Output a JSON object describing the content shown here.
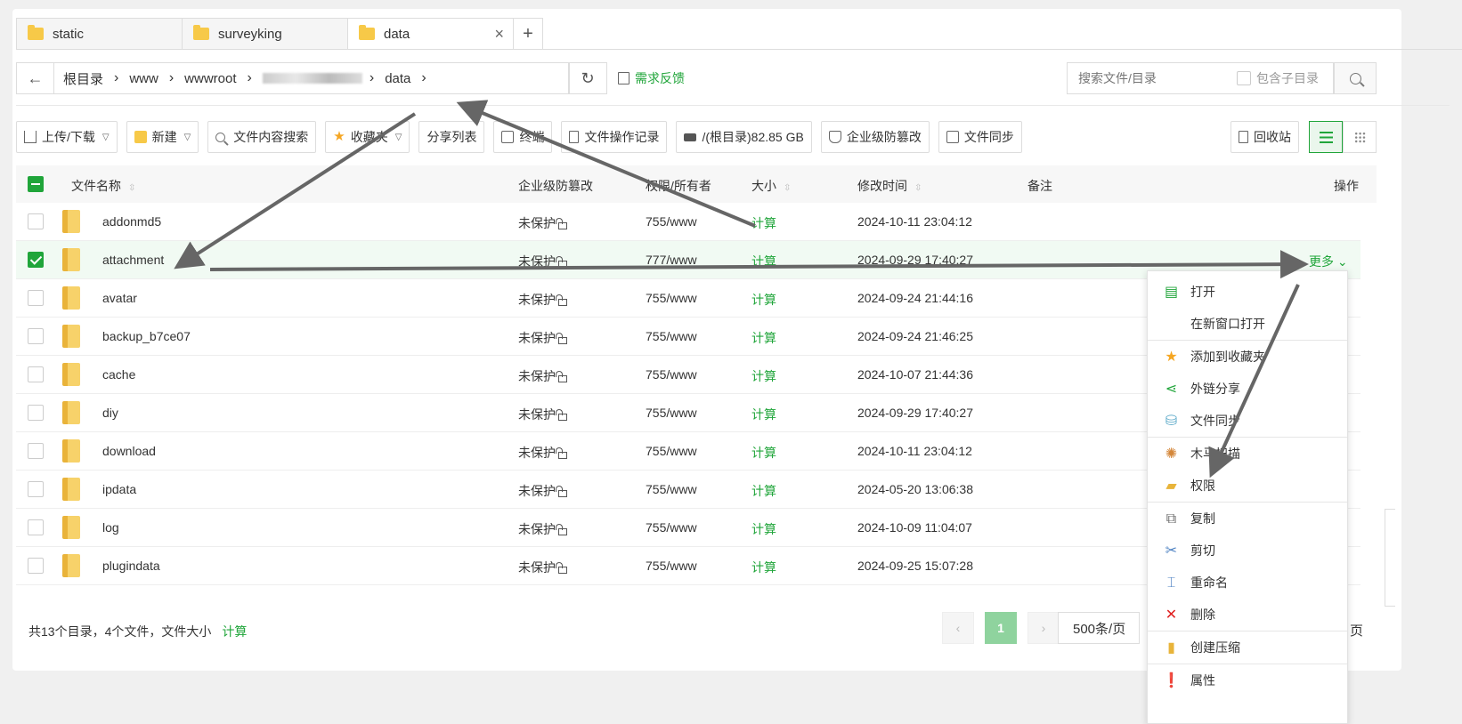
{
  "tabs": [
    {
      "label": "static"
    },
    {
      "label": "surveyking"
    },
    {
      "label": "data"
    }
  ],
  "tab_add": "+",
  "tab_close": "×",
  "breadcrumbs": [
    "根目录",
    "www",
    "wwwroot",
    "data"
  ],
  "feedback": "需求反馈",
  "search": {
    "placeholder": "搜索文件/目录",
    "include_sub": "包含子目录"
  },
  "toolbar": {
    "upload": "上传/下载",
    "new": "新建",
    "content_search": "文件内容搜索",
    "favorites": "收藏夹",
    "share_list": "分享列表",
    "terminal": "终端",
    "op_log": "文件操作记录",
    "disk": "/(根目录)82.85 GB",
    "tamper": "企业级防篡改",
    "sync": "文件同步",
    "recycle": "回收站"
  },
  "table": {
    "headers": {
      "name": "文件名称",
      "tamper": "企业级防篡改",
      "perm": "权限/所有者",
      "size": "大小",
      "mtime": "修改时间",
      "remark": "备注",
      "ops": "操作"
    },
    "rows": [
      {
        "name": "addonmd5",
        "tamper": "未保护",
        "perm": "755/www",
        "size": "计算",
        "mtime": "2024-10-11 23:04:12"
      },
      {
        "name": "attachment",
        "tamper": "未保护",
        "perm": "777/www",
        "size": "计算",
        "mtime": "2024-09-29 17:40:27",
        "ops": "更多"
      },
      {
        "name": "avatar",
        "tamper": "未保护",
        "perm": "755/www",
        "size": "计算",
        "mtime": "2024-09-24 21:44:16"
      },
      {
        "name": "backup_b7ce07",
        "tamper": "未保护",
        "perm": "755/www",
        "size": "计算",
        "mtime": "2024-09-24 21:46:25"
      },
      {
        "name": "cache",
        "tamper": "未保护",
        "perm": "755/www",
        "size": "计算",
        "mtime": "2024-10-07 21:44:36"
      },
      {
        "name": "diy",
        "tamper": "未保护",
        "perm": "755/www",
        "size": "计算",
        "mtime": "2024-09-29 17:40:27"
      },
      {
        "name": "download",
        "tamper": "未保护",
        "perm": "755/www",
        "size": "计算",
        "mtime": "2024-10-11 23:04:12"
      },
      {
        "name": "ipdata",
        "tamper": "未保护",
        "perm": "755/www",
        "size": "计算",
        "mtime": "2024-05-20 13:06:38"
      },
      {
        "name": "log",
        "tamper": "未保护",
        "perm": "755/www",
        "size": "计算",
        "mtime": "2024-10-09 11:04:07"
      },
      {
        "name": "plugindata",
        "tamper": "未保护",
        "perm": "755/www",
        "size": "计算",
        "mtime": "2024-09-25 15:07:28"
      }
    ]
  },
  "footer": {
    "summary": "共13个目录，4个文件，文件大小",
    "calc": "计算"
  },
  "pager": {
    "current": "1",
    "per_page": "500条/页",
    "suffix": "页"
  },
  "context_menu": [
    {
      "label": "打开",
      "icon": "open-icon"
    },
    {
      "label": "在新窗口打开",
      "icon": ""
    },
    {
      "label": "添加到收藏夹",
      "icon": "star-icon"
    },
    {
      "label": "外链分享",
      "icon": "share-icon"
    },
    {
      "label": "文件同步",
      "icon": "sync-icon"
    },
    {
      "label": "木马扫描",
      "icon": "scan-icon"
    },
    {
      "label": "权限",
      "icon": "permission-icon"
    },
    {
      "label": "复制",
      "icon": "copy-icon"
    },
    {
      "label": "剪切",
      "icon": "scissors-icon"
    },
    {
      "label": "重命名",
      "icon": "rename-icon"
    },
    {
      "label": "删除",
      "icon": "delete-icon"
    },
    {
      "label": "创建压缩",
      "icon": "zip-icon"
    },
    {
      "label": "属性",
      "icon": "info-icon"
    }
  ],
  "colors": {
    "accent": "#20a53a",
    "folder": "#f7c948",
    "annotation_arrow": "#666666"
  }
}
